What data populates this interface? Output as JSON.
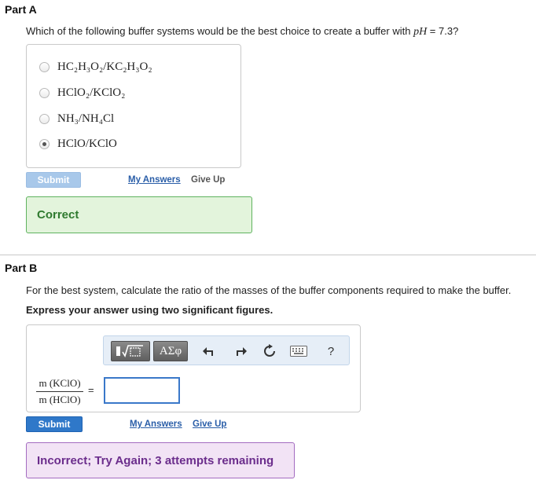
{
  "part_a": {
    "title": "Part A",
    "question_prefix": "Which of the following buffer systems would be the best choice to create a buffer with ",
    "question_ph": "pH",
    "question_suffix": " = 7.3?",
    "options": [
      {
        "label": "HC₂H₃O₂/KC₂H₃O₂",
        "selected": false
      },
      {
        "label": "HClO₂/KClO₂",
        "selected": false
      },
      {
        "label": "NH₃/NH₄Cl",
        "selected": false
      },
      {
        "label": "HClO/KClO",
        "selected": true
      }
    ],
    "submit_label": "Submit",
    "my_answers_label": "My Answers",
    "give_up_label": "Give Up",
    "feedback": "Correct"
  },
  "part_b": {
    "title": "Part B",
    "question": "For the best system, calculate the ratio of the masses of the buffer components required to make the buffer.",
    "instruction": "Express your answer using two significant figures.",
    "toolbar": {
      "template_icon": "template-sqrt-icon",
      "greek_label": "ΑΣφ",
      "undo_icon": "undo-icon",
      "redo_icon": "redo-icon",
      "reset_icon": "reset-icon",
      "keyboard_icon": "keyboard-icon",
      "help_label": "?"
    },
    "fraction_numerator": "m (KClO)",
    "fraction_denominator": "m (HClO)",
    "equals": "=",
    "answer_value": "",
    "submit_label": "Submit",
    "my_answers_label": "My Answers",
    "give_up_label": "Give Up",
    "feedback": "Incorrect; Try Again; 3 attempts remaining"
  },
  "colors": {
    "primary_button": "#2f78c9",
    "disabled_button": "#a8c8ea",
    "correct_bg": "#e3f4dc",
    "correct_text": "#2f7a2f",
    "incorrect_bg": "#f2e3f5",
    "incorrect_text": "#6b2d8c"
  }
}
